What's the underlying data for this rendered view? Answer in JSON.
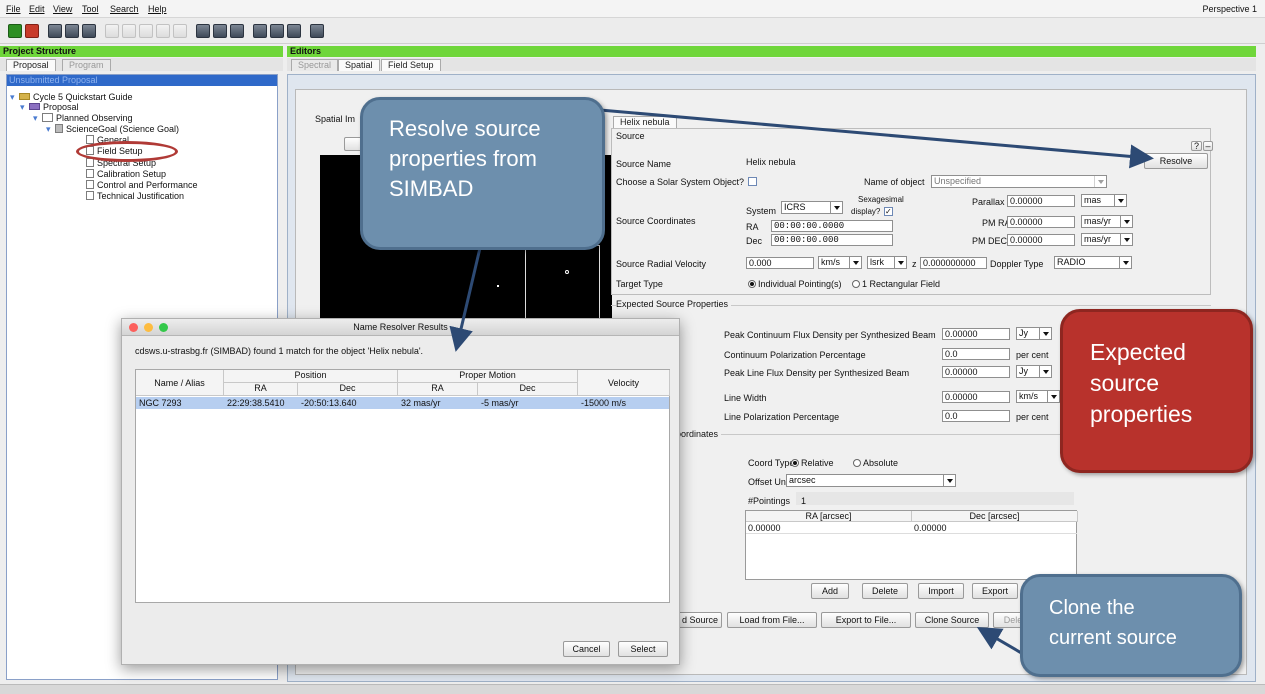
{
  "menu": [
    "File",
    "Edit",
    "View",
    "Tool",
    "Search",
    "Help"
  ],
  "perspective": "Perspective 1",
  "left": {
    "header": "Project Structure",
    "tabs": [
      "Proposal",
      "Program"
    ],
    "selected_title": "Unsubmitted Proposal",
    "tree": [
      {
        "label": "Cycle 5 Quickstart Guide"
      },
      {
        "label": "Proposal"
      },
      {
        "label": "Planned Observing"
      },
      {
        "label": "ScienceGoal (Science Goal)"
      },
      {
        "label": "General"
      },
      {
        "label": "Field Setup"
      },
      {
        "label": "Spectral Setup"
      },
      {
        "label": "Calibration Setup"
      },
      {
        "label": "Control and Performance"
      },
      {
        "label": "Technical Justification"
      }
    ]
  },
  "editors": {
    "header": "Editors",
    "tabs": [
      "Spectral",
      "Spatial",
      "Field Setup"
    ],
    "spatial_image_label": "Spatial Im",
    "source_tab": "Helix nebula",
    "source_group": "Source",
    "source_name_label": "Source Name",
    "source_name": "Helix nebula",
    "resolve": "Resolve",
    "solar_label": "Choose a Solar System Object?",
    "name_of_object_label": "Name of object",
    "name_of_object": "Unspecified",
    "coords_label": "Source Coordinates",
    "system_label": "System",
    "system": "ICRS",
    "sexagesimal_label": "Sexagesimal",
    "display_label": "display?",
    "ra_label": "RA",
    "ra": "00:00:00.0000",
    "dec_label": "Dec",
    "dec": "00:00:00.000",
    "parallax_label": "Parallax",
    "parallax": "0.00000",
    "parallax_unit": "mas",
    "pmra_label": "PM RA",
    "pmra": "0.00000",
    "pmra_unit": "mas/yr",
    "pmdec_label": "PM DEC",
    "pmdec": "0.00000",
    "pmdec_unit": "mas/yr",
    "rv_label": "Source Radial Velocity",
    "rv": "0.000",
    "rv_unit": "km/s",
    "rv_frame": "lsrk",
    "z_label": "z",
    "z": "0.000000000",
    "doppler_label": "Doppler Type",
    "doppler": "RADIO",
    "target_type_label": "Target Type",
    "target_opt1": "Individual Pointing(s)",
    "target_opt2": "1 Rectangular Field",
    "expected_group": "Expected Source Properties",
    "peak_cont_label": "Peak Continuum Flux Density per Synthesized Beam",
    "peak_cont": "0.00000",
    "peak_cont_unit": "Jy",
    "cont_pol_label": "Continuum Polarization Percentage",
    "cont_pol": "0.0",
    "cont_pol_unit": "per cent",
    "peak_line_label": "Peak Line Flux Density per Synthesized Beam",
    "peak_line": "0.00000",
    "peak_line_unit": "Jy",
    "line_width_label": "Line Width",
    "line_width": "0.00000",
    "line_width_unit": "km/s",
    "line_pol_label": "Line Polarization Percentage",
    "line_pol": "0.0",
    "line_pol_unit": "per cent",
    "coords_group": "oordinates",
    "coord_type_label": "Coord Type",
    "coord_rel": "Relative",
    "coord_abs": "Absolute",
    "offset_unit_label": "Offset Unit",
    "offset_unit": "arcsec",
    "pointings_label": "#Pointings",
    "pointings": "1",
    "ptable_headers": [
      "RA [arcsec]",
      "Dec [arcsec]"
    ],
    "ptable_row": [
      "0.00000",
      "0.00000"
    ],
    "ptable_buttons": [
      "Add",
      "Delete",
      "Import",
      "Export"
    ],
    "bottom_buttons": [
      "d Source",
      "Load from File...",
      "Export to File...",
      "Clone Source",
      "Dele"
    ]
  },
  "dialog": {
    "title": "Name Resolver Results",
    "message": "cdsws.u-strasbg.fr (SIMBAD) found 1 match for the object 'Helix nebula'.",
    "headers": {
      "name": "Name / Alias",
      "position": "Position",
      "proper_motion": "Proper Motion",
      "velocity": "Velocity",
      "ra": "RA",
      "dec": "Dec",
      "pm_ra": "RA",
      "pm_dec": "Dec"
    },
    "row": {
      "name": "NGC 7293",
      "ra": "22:29:38.5410",
      "dec": "-20:50:13.640",
      "pm_ra": "32 mas/yr",
      "pm_dec": "-5 mas/yr",
      "velocity": "-15000 m/s"
    },
    "cancel": "Cancel",
    "select": "Select"
  },
  "callouts": {
    "resolve": "Resolve source properties from SIMBAD",
    "resolve_lines": [
      "Resolve source",
      "properties from",
      "SIMBAD"
    ],
    "expected_lines": [
      "Expected",
      "source",
      "properties"
    ],
    "clone_lines": [
      "Clone the",
      "current source"
    ]
  },
  "colors": {
    "accent_green": "#6fd63a",
    "selection_blue": "#2f69c9",
    "callout_blue": "#6d8fad",
    "callout_red": "#b8322c"
  }
}
